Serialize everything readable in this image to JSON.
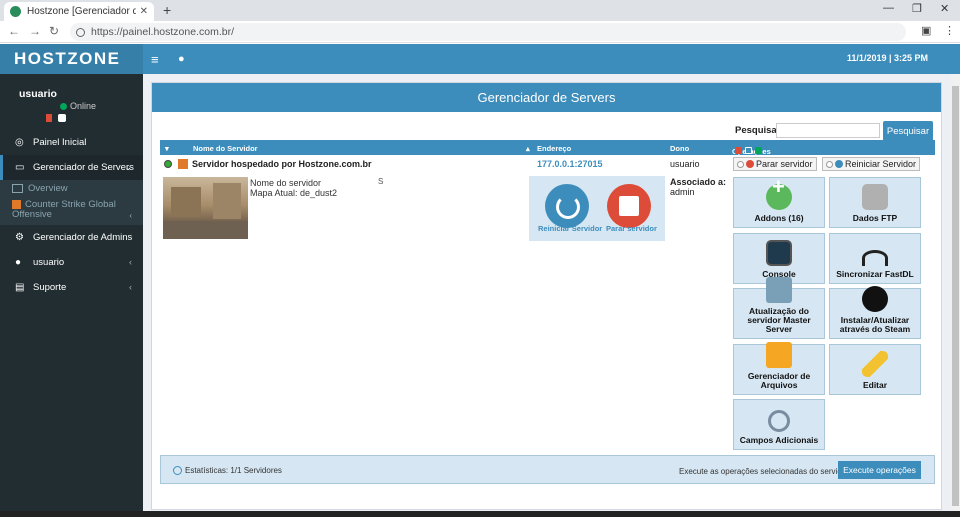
{
  "browser": {
    "tab_title": "Hostzone [Gerenciador de jogos",
    "tab_close": "✕",
    "new_tab": "+",
    "url": "https://painel.hostzone.com.br/",
    "window_controls": [
      "—",
      "❐",
      "✕"
    ]
  },
  "header": {
    "logo": "HOSTZONE",
    "datetime": "11/1/2019 | 3:25 PM"
  },
  "sidebar": {
    "username": "usuario",
    "status": "Online",
    "items": [
      {
        "label": "Painel Inicial"
      },
      {
        "label": "Gerenciador de Servers"
      },
      {
        "label": "Overview"
      },
      {
        "label": "Counter Strike Global Offensive"
      },
      {
        "label": "Gerenciador de Admins"
      },
      {
        "label": "usuario"
      },
      {
        "label": "Suporte"
      }
    ]
  },
  "main": {
    "title": "Gerenciador de Servers",
    "search_label": "Pesquisar:",
    "search_value": "",
    "search_button": "Pesquisar",
    "columns": [
      "Nome do Servidor",
      "Endereço",
      "Dono",
      "Operações"
    ],
    "server": {
      "name": "Servidor hospedado por Hostzone.com.br",
      "address": "177.0.0.1:27015",
      "owner": "usuario",
      "stop_label": "Parar servidor",
      "restart_label": "Reiniciar Servidor",
      "info_name": "Nome do servidor",
      "info_map": "Mapa Atual: de_dust2",
      "s_mark": "S",
      "quick_restart": "Reiniciar Servidor",
      "quick_stop": "Parar servidor",
      "assoc_title": "Associado a:",
      "assoc_value": "admin"
    },
    "tiles": [
      {
        "label": "Addons (16)",
        "icon": "plus-icon"
      },
      {
        "label": "Dados FTP",
        "icon": "ftp-icon"
      },
      {
        "label": "Console",
        "icon": "console-icon"
      },
      {
        "label": "Sincronizar FastDL",
        "icon": "sync-icon"
      },
      {
        "label": "Atualização do servidor Master Server",
        "icon": "master-icon"
      },
      {
        "label": "Instalar/Atualizar através do Steam",
        "icon": "steam-icon"
      },
      {
        "label": "Gerenciador de Arquivos",
        "icon": "folder-icon"
      },
      {
        "label": "Editar",
        "icon": "pencil-icon"
      },
      {
        "label": "Campos Adicionais",
        "icon": "search-icon"
      }
    ],
    "footer": {
      "stats": "Estatísticas: 1/1 Servidores",
      "exec_label": "Execute as operações selecionadas do servidor",
      "exec_button": "Execute operações"
    }
  },
  "colors": {
    "primary": "#3c8dbc",
    "sidebar": "#222d32",
    "danger": "#dd4b39",
    "success": "#00a65a"
  }
}
